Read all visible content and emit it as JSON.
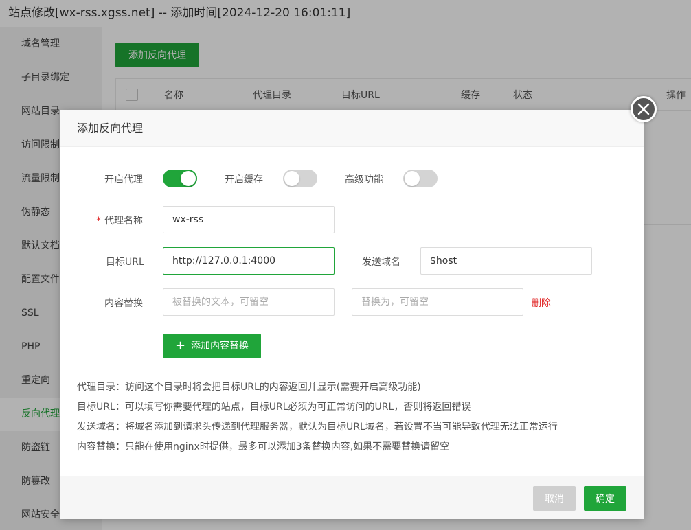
{
  "window": {
    "title": "站点修改[wx-rss.xgss.net] -- 添加时间[2024-12-20 16:01:11]"
  },
  "sidebar": {
    "items": [
      {
        "label": "域名管理"
      },
      {
        "label": "子目录绑定"
      },
      {
        "label": "网站目录"
      },
      {
        "label": "访问限制"
      },
      {
        "label": "流量限制"
      },
      {
        "label": "伪静态"
      },
      {
        "label": "默认文档"
      },
      {
        "label": "配置文件"
      },
      {
        "label": "SSL"
      },
      {
        "label": "PHP"
      },
      {
        "label": "重定向"
      },
      {
        "label": "反向代理"
      },
      {
        "label": "防盗链"
      },
      {
        "label": "防篡改"
      },
      {
        "label": "网站安全"
      }
    ],
    "active_index": 11
  },
  "content": {
    "add_proxy_button": "添加反向代理",
    "table": {
      "columns": [
        "名称",
        "代理目录",
        "目标URL",
        "缓存",
        "状态",
        "操作"
      ]
    }
  },
  "modal": {
    "title": "添加反向代理",
    "toggles": {
      "proxy": {
        "label": "开启代理",
        "on": true
      },
      "cache": {
        "label": "开启缓存",
        "on": false
      },
      "advanced": {
        "label": "高级功能",
        "on": false
      }
    },
    "proxy_name": {
      "required_mark": "*",
      "label": "代理名称",
      "value": "wx-rss"
    },
    "target_url": {
      "label": "目标URL",
      "value": "http://127.0.0.1:4000"
    },
    "send_domain": {
      "label": "发送域名",
      "value": "$host"
    },
    "content_replace": {
      "label": "内容替换",
      "find_placeholder": "被替换的文本，可留空",
      "replace_placeholder": "替换为，可留空",
      "delete_label": "删除"
    },
    "add_content_button": "添加内容替换",
    "help_lines": [
      "代理目录：访问这个目录时将会把目标URL的内容返回并显示(需要开启高级功能)",
      "目标URL：可以填写你需要代理的站点，目标URL必须为可正常访问的URL，否则将返回错误",
      "发送域名：将域名添加到请求头传递到代理服务器，默认为目标URL域名，若设置不当可能导致代理无法正常运行",
      "内容替换：只能在使用nginx时提供，最多可以添加3条替换内容,如果不需要替换请留空"
    ],
    "cancel_button": "取消",
    "confirm_button": "确定"
  },
  "colors": {
    "accent": "#20a53a",
    "danger": "#e02020"
  }
}
